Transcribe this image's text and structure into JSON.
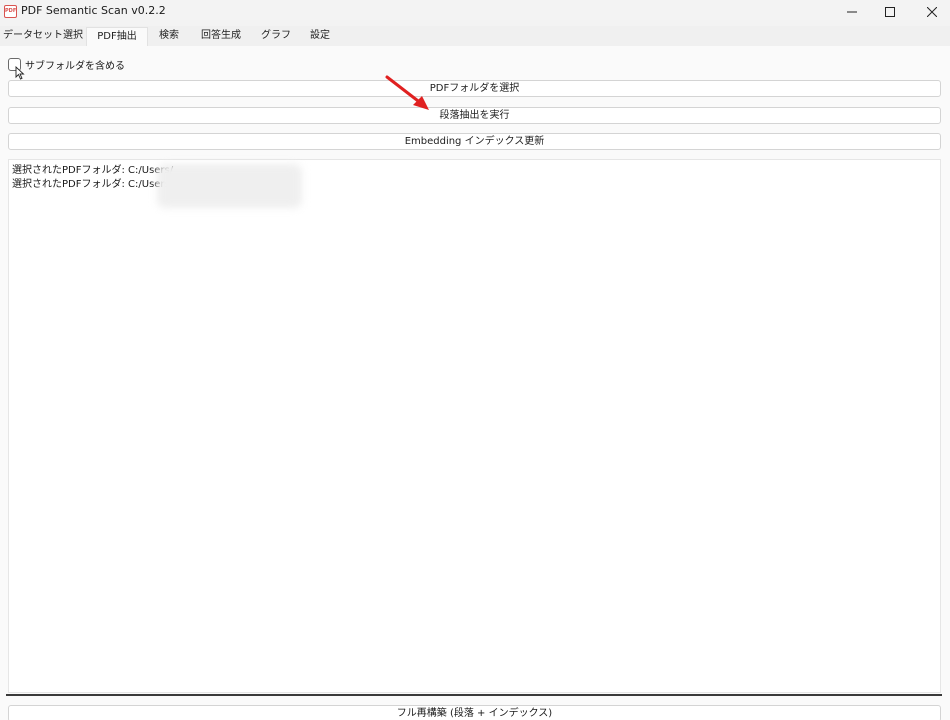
{
  "window": {
    "title": "PDF Semantic Scan v0.2.2",
    "icon_label": "PDF"
  },
  "tabs": [
    {
      "label": "データセット選択"
    },
    {
      "label": "PDF抽出"
    },
    {
      "label": "検索"
    },
    {
      "label": "回答生成"
    },
    {
      "label": "グラフ"
    },
    {
      "label": "設定"
    }
  ],
  "active_tab": "PDF抽出",
  "options": {
    "include_subfolders_label": "サブフォルダを含める",
    "include_subfolders_checked": false
  },
  "buttons": {
    "select_folder": "PDFフォルダを選択",
    "run_extraction": "段落抽出を実行",
    "update_index": "Embedding インデックス更新",
    "full_rebuild": "フル再構築 (段落 + インデックス)"
  },
  "log": {
    "lines": [
      "選択されたPDFフォルダ: C:/Users/",
      "選択されたPDFフォルダ: C:/Users/"
    ]
  },
  "colors": {
    "annotation_arrow": "#e02020",
    "background": "#f3f3f3",
    "panel": "#fafafa"
  }
}
